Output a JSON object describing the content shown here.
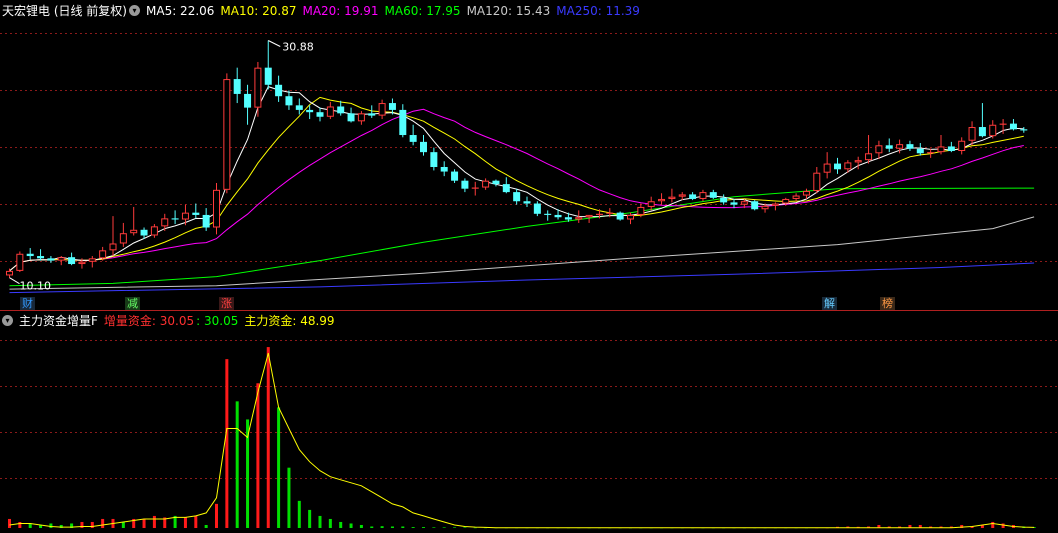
{
  "upper_header": {
    "title": "天宏锂电 (日线 前复权)",
    "ma_items": [
      {
        "label": "MA5: 22.06",
        "color": "#ffffff"
      },
      {
        "label": "MA10: 20.87",
        "color": "#ffff00"
      },
      {
        "label": "MA20: 19.91",
        "color": "#ff00ff"
      },
      {
        "label": "MA60: 17.95",
        "color": "#00ff00"
      },
      {
        "label": "MA120: 15.43",
        "color": "#c8c8c8"
      },
      {
        "label": "MA250: 11.39",
        "color": "#3a3aff"
      }
    ]
  },
  "lower_header": {
    "title": "主力资金增量F",
    "items": [
      {
        "label": "增量资金: 30.05",
        "color": "#ff3030"
      },
      {
        "label": ": 30.05",
        "color": "#00ff00"
      },
      {
        "label": "主力资金: 48.99",
        "color": "#ffff00"
      }
    ]
  },
  "event_tags": [
    {
      "text": "财",
      "color": "#3399ff",
      "bg": "#18283a"
    },
    {
      "text": "减",
      "color": "#66ff66",
      "bg": "#183a18"
    },
    {
      "text": "涨",
      "color": "#ff4040",
      "bg": "#3a1818"
    },
    {
      "text": "解",
      "color": "#66ccff",
      "bg": "#182a3a"
    },
    {
      "text": "榜",
      "color": "#ff9944",
      "bg": "#3a2818"
    }
  ],
  "colors": {
    "up": "#ff3b3b",
    "down": "#54ffff",
    "grid": "#8b1a1a",
    "flat": "#ffffff"
  },
  "chart_data": [
    {
      "type": "candlestick",
      "high_label": "30.88",
      "low_label": "10.10",
      "candles": [
        [
          10.3,
          10.9,
          10.1,
          10.7
        ],
        [
          10.7,
          12.4,
          10.6,
          12.2
        ],
        [
          12.2,
          12.7,
          11.7,
          12.0
        ],
        [
          12.0,
          12.6,
          11.6,
          11.8
        ],
        [
          11.8,
          12.0,
          11.4,
          11.6
        ],
        [
          11.6,
          12.0,
          11.2,
          11.9
        ],
        [
          11.9,
          12.3,
          11.2,
          11.3
        ],
        [
          11.3,
          11.8,
          10.9,
          11.5
        ],
        [
          11.5,
          12.0,
          11.0,
          11.8
        ],
        [
          11.8,
          12.8,
          11.6,
          12.5
        ],
        [
          12.5,
          15.5,
          12.0,
          13.1
        ],
        [
          13.1,
          14.9,
          12.8,
          14.0
        ],
        [
          14.0,
          16.3,
          13.8,
          14.3
        ],
        [
          14.3,
          14.5,
          13.5,
          13.8
        ],
        [
          13.8,
          14.8,
          13.6,
          14.6
        ],
        [
          14.6,
          15.7,
          14.2,
          15.3
        ],
        [
          15.3,
          16.0,
          14.8,
          15.2
        ],
        [
          15.2,
          16.5,
          14.7,
          15.8
        ],
        [
          15.8,
          16.6,
          15.3,
          15.6
        ],
        [
          15.6,
          16.2,
          14.2,
          14.5
        ],
        [
          14.5,
          18.4,
          13.9,
          17.8
        ],
        [
          17.8,
          28.0,
          17.5,
          27.5
        ],
        [
          27.5,
          28.5,
          25.4,
          26.2
        ],
        [
          26.2,
          27.0,
          23.5,
          25.0
        ],
        [
          25.0,
          29.0,
          24.2,
          28.5
        ],
        [
          28.5,
          30.88,
          26.6,
          27.0
        ],
        [
          27.0,
          27.8,
          25.5,
          26.0
        ],
        [
          26.0,
          26.5,
          24.8,
          25.2
        ],
        [
          25.2,
          25.8,
          24.4,
          24.8
        ],
        [
          24.8,
          25.2,
          24.0,
          24.6
        ],
        [
          24.6,
          25.0,
          23.8,
          24.2
        ],
        [
          24.2,
          25.5,
          24.0,
          25.1
        ],
        [
          25.1,
          25.6,
          24.3,
          24.5
        ],
        [
          24.5,
          25.0,
          23.7,
          23.8
        ],
        [
          23.8,
          24.7,
          23.5,
          24.5
        ],
        [
          24.5,
          25.2,
          24.1,
          24.3
        ],
        [
          24.3,
          25.7,
          24.0,
          25.4
        ],
        [
          25.4,
          25.8,
          24.4,
          24.8
        ],
        [
          24.8,
          25.3,
          22.4,
          22.6
        ],
        [
          22.6,
          23.5,
          21.7,
          22.0
        ],
        [
          22.0,
          22.6,
          20.8,
          21.1
        ],
        [
          21.1,
          21.5,
          19.5,
          19.8
        ],
        [
          19.8,
          20.3,
          19.0,
          19.4
        ],
        [
          19.4,
          19.6,
          18.4,
          18.6
        ],
        [
          18.6,
          18.8,
          17.6,
          17.9
        ],
        [
          17.9,
          18.5,
          17.3,
          18.0
        ],
        [
          18.0,
          18.8,
          17.8,
          18.6
        ],
        [
          18.6,
          18.7,
          18.1,
          18.3
        ],
        [
          18.3,
          18.9,
          17.5,
          17.6
        ],
        [
          17.6,
          17.9,
          16.5,
          16.8
        ],
        [
          16.8,
          17.2,
          16.3,
          16.6
        ],
        [
          16.6,
          16.8,
          15.5,
          15.7
        ],
        [
          15.7,
          16.0,
          15.1,
          15.6
        ],
        [
          15.6,
          16.1,
          15.2,
          15.4
        ],
        [
          15.4,
          15.8,
          15.0,
          15.2
        ],
        [
          15.2,
          16.0,
          14.9,
          15.4
        ],
        [
          15.4,
          15.6,
          14.9,
          15.6
        ],
        [
          15.6,
          16.1,
          15.3,
          15.7
        ],
        [
          15.7,
          16.2,
          15.4,
          15.8
        ],
        [
          15.8,
          15.9,
          15.1,
          15.2
        ],
        [
          15.2,
          15.8,
          14.8,
          15.6
        ],
        [
          15.6,
          16.6,
          15.4,
          16.3
        ],
        [
          16.3,
          17.2,
          16.0,
          16.8
        ],
        [
          16.8,
          17.5,
          16.5,
          17.0
        ],
        [
          17.0,
          17.9,
          16.7,
          17.2
        ],
        [
          17.2,
          17.6,
          16.9,
          17.4
        ],
        [
          17.4,
          17.6,
          16.9,
          17.0
        ],
        [
          17.0,
          17.8,
          16.8,
          17.6
        ],
        [
          17.6,
          17.8,
          17.0,
          17.1
        ],
        [
          17.1,
          17.4,
          16.5,
          16.7
        ],
        [
          16.7,
          17.0,
          16.2,
          16.5
        ],
        [
          16.5,
          17.0,
          16.2,
          16.8
        ],
        [
          16.8,
          16.9,
          16.0,
          16.1
        ],
        [
          16.1,
          16.6,
          15.8,
          16.4
        ],
        [
          16.4,
          16.7,
          16.0,
          16.6
        ],
        [
          16.6,
          17.1,
          16.4,
          17.0
        ],
        [
          17.0,
          17.5,
          16.8,
          17.3
        ],
        [
          17.3,
          17.9,
          17.0,
          17.7
        ],
        [
          17.7,
          19.8,
          17.5,
          19.3
        ],
        [
          19.3,
          21.1,
          18.8,
          20.1
        ],
        [
          20.1,
          20.6,
          19.2,
          19.6
        ],
        [
          19.6,
          20.4,
          19.3,
          20.2
        ],
        [
          20.2,
          20.7,
          19.6,
          20.4
        ],
        [
          20.4,
          22.6,
          20.1,
          21.0
        ],
        [
          21.0,
          22.1,
          20.5,
          21.7
        ],
        [
          21.7,
          22.3,
          21.1,
          21.4
        ],
        [
          21.4,
          22.2,
          21.0,
          21.8
        ],
        [
          21.8,
          22.1,
          21.2,
          21.4
        ],
        [
          21.4,
          21.9,
          20.8,
          21.0
        ],
        [
          21.0,
          21.4,
          20.6,
          21.1
        ],
        [
          21.1,
          22.6,
          20.9,
          21.6
        ],
        [
          21.6,
          22.0,
          21.1,
          21.2
        ],
        [
          21.2,
          22.4,
          20.9,
          22.1
        ],
        [
          22.1,
          23.8,
          21.7,
          23.3
        ],
        [
          23.3,
          25.4,
          22.4,
          22.5
        ],
        [
          22.5,
          23.9,
          22.3,
          23.5
        ],
        [
          23.5,
          24.0,
          22.7,
          23.6
        ],
        [
          23.6,
          24.0,
          23.0,
          23.1
        ],
        [
          23.1,
          23.3,
          22.8,
          23.0
        ]
      ],
      "moving_averages": [
        {
          "name": "MA5",
          "color": "#ffffff",
          "last": 22.06
        },
        {
          "name": "MA10",
          "color": "#ffff00",
          "last": 20.87
        },
        {
          "name": "MA20",
          "color": "#ff00ff",
          "last": 19.91
        },
        {
          "name": "MA60",
          "color": "#00ff00",
          "last": 17.95
        },
        {
          "name": "MA120",
          "color": "#c8c8c8",
          "last": 15.43
        },
        {
          "name": "MA250",
          "color": "#3a3aff",
          "last": 11.39
        }
      ],
      "ma_paths": {
        "MA60": [
          [
            0,
            9.4
          ],
          [
            10,
            9.6
          ],
          [
            20,
            10.2
          ],
          [
            30,
            11.6
          ],
          [
            40,
            13.2
          ],
          [
            50,
            14.6
          ],
          [
            60,
            15.8
          ],
          [
            70,
            17.2
          ],
          [
            80,
            17.9
          ],
          [
            99,
            17.95
          ]
        ],
        "MA120": [
          [
            0,
            9.1
          ],
          [
            20,
            9.4
          ],
          [
            40,
            10.5
          ],
          [
            60,
            11.8
          ],
          [
            80,
            13.0
          ],
          [
            95,
            14.4
          ],
          [
            99,
            15.43
          ]
        ],
        "MA250": [
          [
            0,
            8.8
          ],
          [
            30,
            9.3
          ],
          [
            50,
            9.9
          ],
          [
            70,
            10.4
          ],
          [
            90,
            11.0
          ],
          [
            99,
            11.39
          ]
        ]
      },
      "ylim": [
        8.5,
        32.5
      ]
    },
    {
      "type": "bar",
      "series_name": "增量资金",
      "line_name": "主力资金",
      "values": [
        3,
        2,
        1.5,
        1,
        1.5,
        1,
        1.5,
        2,
        2,
        3,
        3,
        2,
        3,
        3,
        4,
        3.5,
        4,
        3.5,
        4,
        1,
        8,
        56,
        42,
        36,
        48,
        60,
        40,
        20,
        9,
        6,
        4,
        3,
        2,
        1.5,
        1,
        0.5,
        0.6,
        0.5,
        0.5,
        0.3,
        0.3,
        0.2,
        0.2,
        0.2,
        0.2,
        0.1,
        0.1,
        0.1,
        0.1,
        0.1,
        0.1,
        0.1,
        0.1,
        0.1,
        0.1,
        0.1,
        0.1,
        0.1,
        0.1,
        0.1,
        0.1,
        0.1,
        0.1,
        0.1,
        0.1,
        0.1,
        0.1,
        0.1,
        0.1,
        0.1,
        0.1,
        0.1,
        0.1,
        0.1,
        0.1,
        0.1,
        0.1,
        0.1,
        0.1,
        0.1,
        0.4,
        0.5,
        0.4,
        0.5,
        1,
        0.5,
        0.5,
        1,
        1,
        0.5,
        0.5,
        0.5,
        1,
        0.5,
        1,
        2,
        1.5,
        1,
        0.5,
        0.3
      ],
      "bar_colors": [
        "r",
        "r",
        "g",
        "g",
        "g",
        "g",
        "g",
        "r",
        "r",
        "r",
        "r",
        "g",
        "r",
        "r",
        "r",
        "r",
        "g",
        "r",
        "r",
        "g",
        "r",
        "r",
        "g",
        "g",
        "r",
        "r",
        "g",
        "g",
        "g",
        "g",
        "g",
        "g",
        "g",
        "g",
        "g",
        "g",
        "g",
        "g",
        "g",
        "g",
        "g",
        "g",
        "g",
        "g",
        "g",
        "g",
        "g",
        "g",
        "g",
        "g",
        "g",
        "g",
        "g",
        "g",
        "g",
        "g",
        "g",
        "g",
        "g",
        "g",
        "g",
        "g",
        "g",
        "g",
        "g",
        "g",
        "g",
        "g",
        "g",
        "g",
        "g",
        "g",
        "g",
        "g",
        "g",
        "g",
        "g",
        "g",
        "r",
        "r",
        "r",
        "r",
        "r",
        "r",
        "r",
        "r",
        "r",
        "r",
        "r",
        "r",
        "r",
        "r",
        "r",
        "r",
        "r",
        "r",
        "r",
        "r",
        "g",
        "g"
      ],
      "line": [
        1,
        1.5,
        1.5,
        1,
        0.5,
        0.3,
        0.3,
        0.5,
        0.5,
        1,
        1.5,
        2,
        2.5,
        3,
        3,
        3,
        3.5,
        3.5,
        4,
        5,
        10,
        33,
        33,
        30,
        45,
        58,
        40,
        33,
        26,
        22,
        19,
        17,
        16,
        15,
        14,
        12,
        10,
        8,
        7,
        5,
        4,
        3,
        2,
        1,
        0.5,
        0.3,
        0.2,
        0.1,
        0.1,
        0.1,
        0.1,
        0.1,
        0.1,
        0.1,
        0.1,
        0.1,
        0.1,
        0.1,
        0.1,
        0.1,
        0.1,
        0.1,
        0.1,
        0.1,
        0.1,
        0.1,
        0.1,
        0.1,
        0.1,
        0.1,
        0.1,
        0.1,
        0.1,
        0.1,
        0.1,
        0.1,
        0.1,
        0.1,
        0.1,
        0.1,
        0.1,
        0.1,
        0.1,
        0.1,
        0.1,
        0.1,
        0.1,
        0.1,
        0.1,
        0.1,
        0.1,
        0.1,
        0.3,
        0.5,
        1,
        1.5,
        1,
        0.5,
        0.3,
        0.2
      ],
      "ylim": [
        0,
        65
      ]
    }
  ]
}
